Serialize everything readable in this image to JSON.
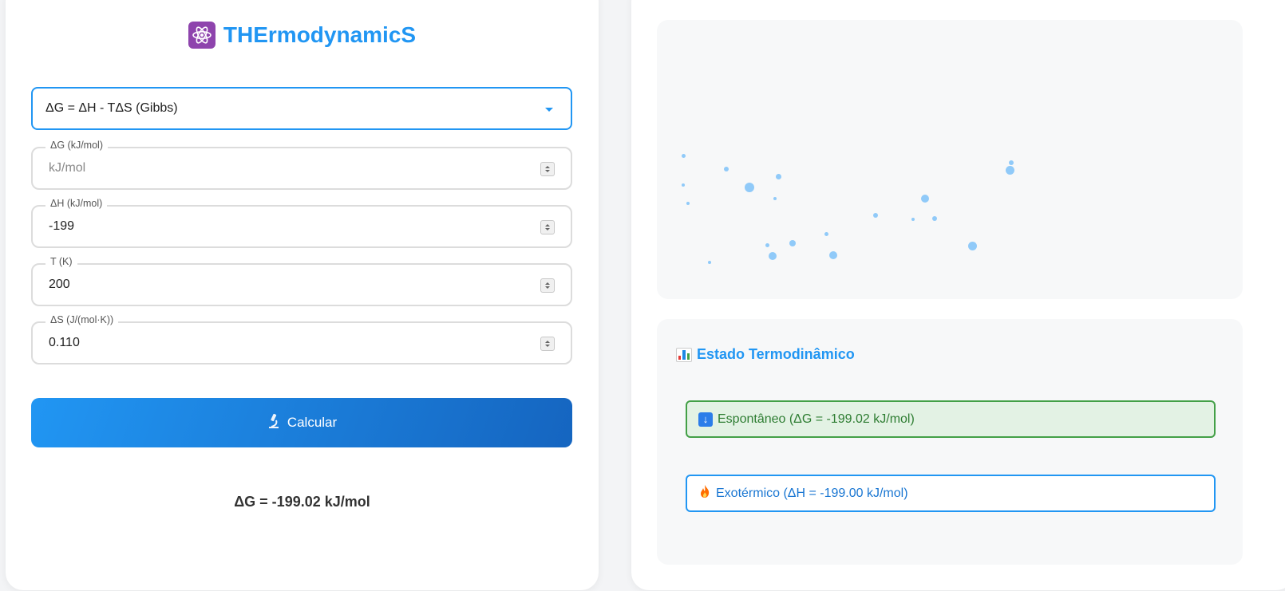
{
  "app": {
    "title": "THErmodynamicS"
  },
  "form": {
    "equation_select": "ΔG = ΔH - TΔS (Gibbs)",
    "fields": [
      {
        "label": "ΔG (kJ/mol)",
        "value": "",
        "placeholder": "kJ/mol"
      },
      {
        "label": "ΔH (kJ/mol)",
        "value": "-199",
        "placeholder": ""
      },
      {
        "label": "T (K)",
        "value": "200",
        "placeholder": ""
      },
      {
        "label": "ΔS (J/(mol·K))",
        "value": "0.110",
        "placeholder": ""
      }
    ],
    "calc_button": "Calcular",
    "result": "ΔG = -199.02 kJ/mol"
  },
  "status": {
    "title": "Estado Termodinâmico",
    "spontaneity": "Espontâneo (ΔG = -199.02 kJ/mol)",
    "enthalpy": "Exotérmico (ΔH = -199.00 kJ/mol)"
  },
  "colors": {
    "accent": "#2196f3",
    "accent_dark": "#1565c0",
    "success": "#43a047",
    "particle": "#90caf9"
  },
  "icons": {
    "title": "atom-icon",
    "button": "microscope-icon",
    "status_title": "bar-chart-icon",
    "spontaneous": "down-arrow-icon",
    "exothermic": "fire-icon"
  }
}
